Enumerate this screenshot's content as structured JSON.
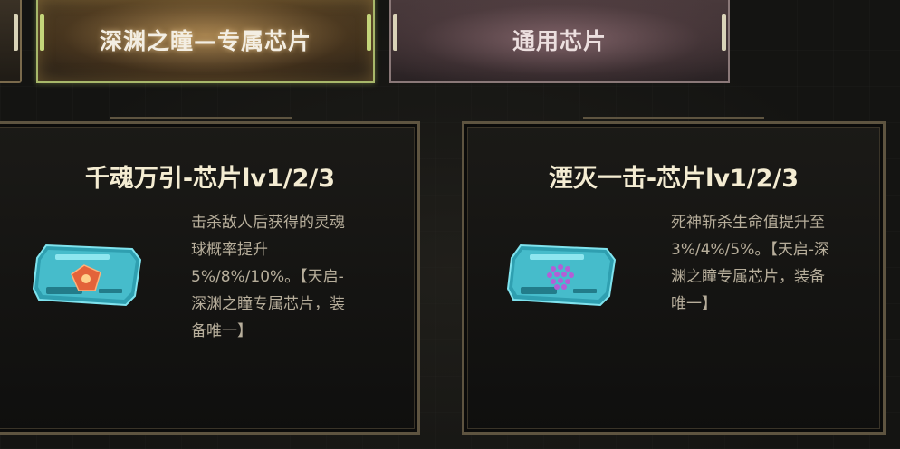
{
  "tabs": [
    {
      "label": "",
      "selected": false
    },
    {
      "label": "深渊之瞳—专属芯片",
      "selected": true
    },
    {
      "label": "通用芯片",
      "selected": false
    }
  ],
  "cards": [
    {
      "title": "千魂万引-芯片lv1/2/3",
      "icon": "chip-soul-icon",
      "desc_lines": [
        "击杀敌人后获得的灵魂",
        "球概率提升",
        "5%/8%/10%。【天启-",
        "深渊之瞳专属芯片，装",
        "备唯一】"
      ]
    },
    {
      "title": "湮灭一击-芯片lv1/2/3",
      "icon": "chip-strike-icon",
      "desc_lines": [
        "死神斩杀生命值提升至",
        "3%/4%/5%。【天启-深",
        "渊之瞳专属芯片，装备",
        "唯一】"
      ]
    }
  ],
  "colors": {
    "accent_gold": "#a8b86a",
    "chip_cyan": "#3fb6c4",
    "title_text": "#f4ecd2",
    "desc_text": "#b7ae9b"
  }
}
